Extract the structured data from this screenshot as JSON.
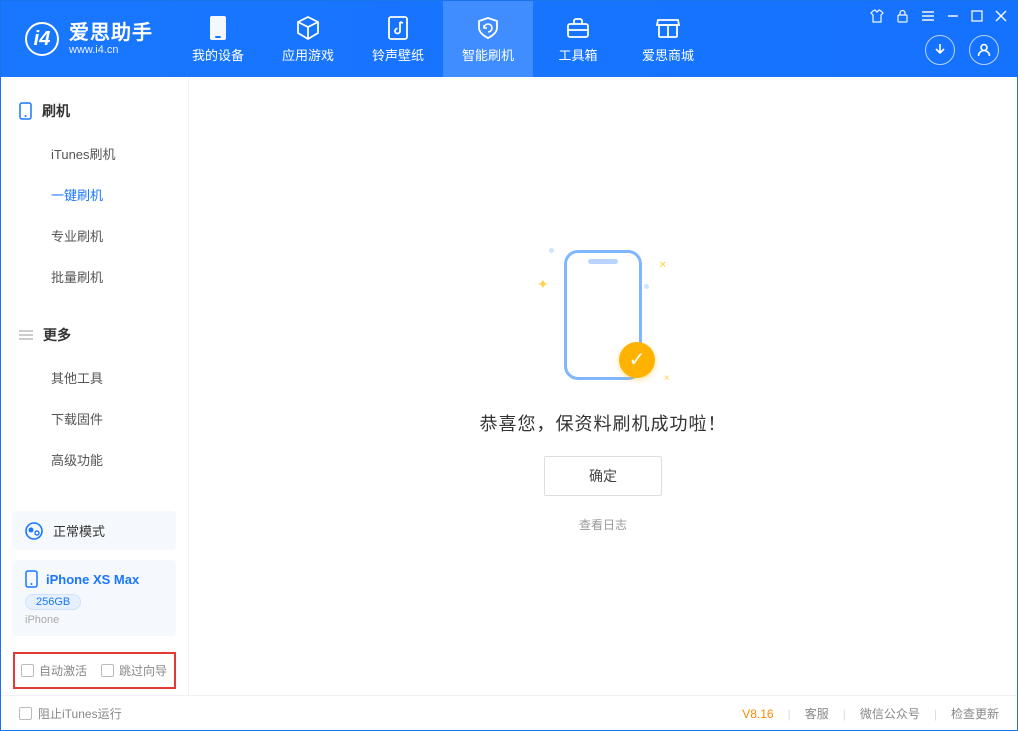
{
  "app": {
    "name": "爱思助手",
    "url": "www.i4.cn"
  },
  "nav": {
    "items": [
      {
        "label": "我的设备"
      },
      {
        "label": "应用游戏"
      },
      {
        "label": "铃声壁纸"
      },
      {
        "label": "智能刷机"
      },
      {
        "label": "工具箱"
      },
      {
        "label": "爱思商城"
      }
    ],
    "activeIndex": 3
  },
  "sidebar": {
    "section1": {
      "title": "刷机",
      "items": [
        "iTunes刷机",
        "一键刷机",
        "专业刷机",
        "批量刷机"
      ],
      "activeIndex": 1
    },
    "section2": {
      "title": "更多",
      "items": [
        "其他工具",
        "下载固件",
        "高级功能"
      ]
    }
  },
  "status": {
    "mode": "正常模式"
  },
  "device": {
    "name": "iPhone XS Max",
    "storage": "256GB",
    "type": "iPhone"
  },
  "options": {
    "autoActivate": "自动激活",
    "skipWizard": "跳过向导"
  },
  "result": {
    "message": "恭喜您，保资料刷机成功啦！",
    "confirm": "确定",
    "viewLog": "查看日志"
  },
  "footer": {
    "blockItunes": "阻止iTunes运行",
    "version": "V8.16",
    "links": [
      "客服",
      "微信公众号",
      "检查更新"
    ]
  }
}
